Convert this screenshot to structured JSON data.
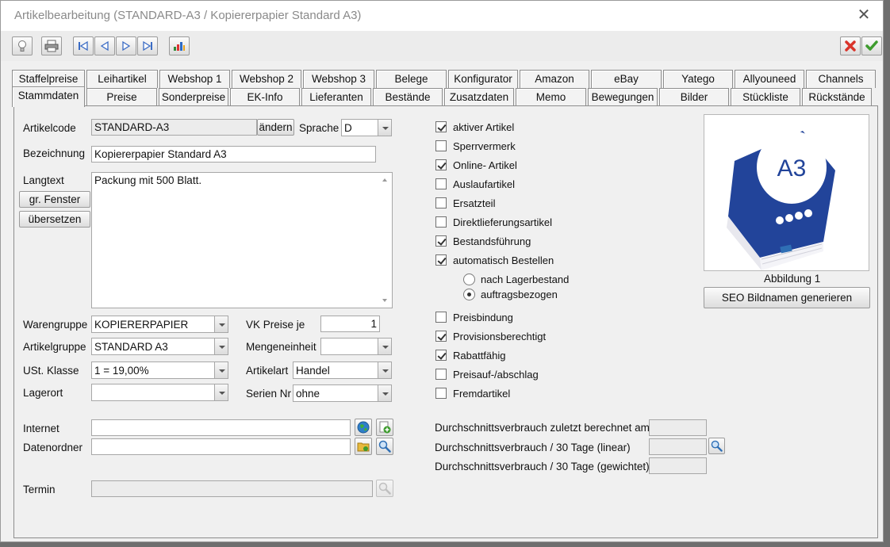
{
  "window": {
    "title": "Artikelbearbeitung (STANDARD-A3 / Kopiererpapier Standard A3)"
  },
  "toolbar": {
    "left_icons": [
      "lightbulb-icon",
      "printer-icon",
      "first-record-icon",
      "previous-record-icon",
      "next-record-icon",
      "last-record-icon",
      "chart-icon"
    ],
    "right_icons": [
      "cancel-icon",
      "confirm-icon"
    ]
  },
  "tabs": {
    "row1": [
      "Staffelpreise",
      "Leihartikel",
      "Webshop 1",
      "Webshop 2",
      "Webshop 3",
      "Belege",
      "Konfigurator",
      "Amazon",
      "eBay",
      "Yatego",
      "Allyouneed",
      "Channels"
    ],
    "row2": [
      "Stammdaten",
      "Preise",
      "Sonderpreise",
      "EK-Info",
      "Lieferanten",
      "Bestände",
      "Zusatzdaten",
      "Memo",
      "Bewegungen",
      "Bilder",
      "Stückliste",
      "Rückstände"
    ],
    "active": "Stammdaten"
  },
  "form": {
    "artikelcode_label": "Artikelcode",
    "artikelcode_value": "STANDARD-A3",
    "aendern_button": "ändern",
    "sprache_label": "Sprache",
    "sprache_value": "D",
    "bezeichnung_label": "Bezeichnung",
    "bezeichnung_value": "Kopiererpapier Standard A3",
    "langtext_label": "Langtext",
    "langtext_value": "Packung mit 500 Blatt.",
    "gr_fenster_button": "gr. Fenster",
    "uebersetzen_button": "übersetzen",
    "warengruppe_label": "Warengruppe",
    "warengruppe_value": "KOPIERERPAPIER",
    "artikelgruppe_label": "Artikelgruppe",
    "artikelgruppe_value": "STANDARD A3",
    "ust_label": "USt. Klasse",
    "ust_value": "1 = 19,00%",
    "lagerort_label": "Lagerort",
    "lagerort_value": "",
    "vk_preise_label": "VK Preise je",
    "vk_preise_value": "1",
    "mengeneinheit_label": "Mengeneinheit",
    "mengeneinheit_value": "",
    "artikelart_label": "Artikelart",
    "artikelart_value": "Handel",
    "seriennr_label": "Serien Nr",
    "seriennr_value": "ohne",
    "internet_label": "Internet",
    "internet_value": "",
    "datenordner_label": "Datenordner",
    "datenordner_value": "",
    "termin_label": "Termin",
    "termin_value": ""
  },
  "checkboxes": [
    {
      "label": "aktiver Artikel",
      "checked": true
    },
    {
      "label": "Sperrvermerk",
      "checked": false
    },
    {
      "label": "Online- Artikel",
      "checked": true
    },
    {
      "label": "Auslaufartikel",
      "checked": false
    },
    {
      "label": "Ersatzteil",
      "checked": false
    },
    {
      "label": "Direktlieferungsartikel",
      "checked": false
    },
    {
      "label": "Bestandsführung",
      "checked": true
    },
    {
      "label": "automatisch Bestellen",
      "checked": true
    },
    {
      "label": "Preisbindung",
      "checked": false
    },
    {
      "label": "Provisionsberechtigt",
      "checked": true
    },
    {
      "label": "Rabattfähig",
      "checked": true
    },
    {
      "label": "Preisauf-/abschlag",
      "checked": false
    },
    {
      "label": "Fremdartikel",
      "checked": false
    }
  ],
  "radios": [
    {
      "label": "nach Lagerbestand",
      "selected": false
    },
    {
      "label": "auftragsbezogen",
      "selected": true
    }
  ],
  "image": {
    "caption": "Abbildung 1",
    "seo_button": "SEO Bildnamen generieren",
    "package_text": "A3"
  },
  "verbrauch": {
    "zuletzt_label": "Durchschnittsverbrauch zuletzt berechnet am",
    "linear_label": "Durchschnittsverbrauch / 30 Tage (linear)",
    "gewichtet_label": "Durchschnittsverbrauch / 30 Tage (gewichtet)"
  },
  "colors": {
    "cancel": "#d9342b",
    "confirm": "#3e9c2e",
    "package_blue": "#22449a"
  }
}
